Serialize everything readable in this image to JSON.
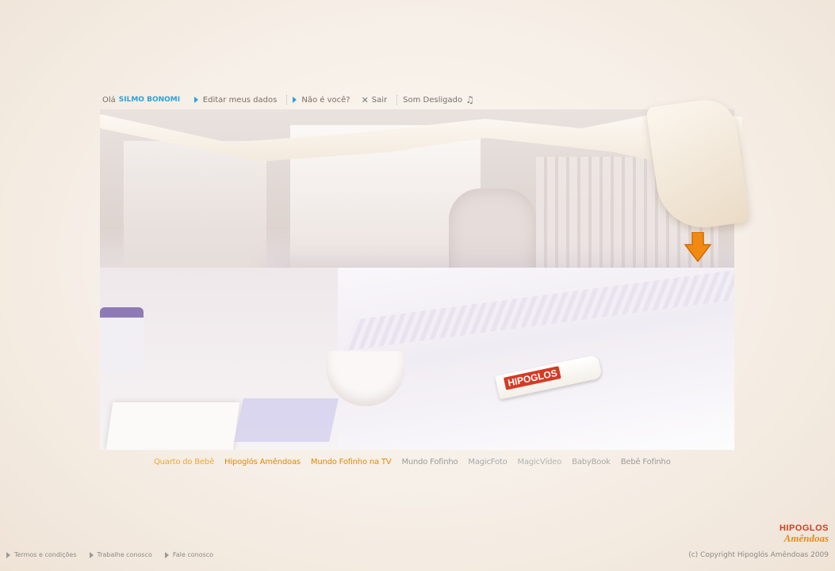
{
  "user_bar": {
    "greeting": "Olá",
    "username": "SILMO BONOMI",
    "edit_link": "Editar meus dados",
    "not_you_link": "Não é você?",
    "logout_link": "Sair",
    "sound_label": "Som Desligado"
  },
  "hero": {
    "product_label": "HIPOGLOS"
  },
  "menu": [
    {
      "label": "Quarto do Bebê",
      "color": "#f0a630"
    },
    {
      "label": "Hipoglós Amêndoas",
      "color": "#e38a00"
    },
    {
      "label": "Mundo Fofinho na TV",
      "color": "#e38a00"
    },
    {
      "label": "Mundo Fofinho",
      "color": "#9a9a9a"
    },
    {
      "label": "MagicFoto",
      "color": "#a8a8a8"
    },
    {
      "label": "MagicVídeo",
      "color": "#b3b3b3"
    },
    {
      "label": "BabyBook",
      "color": "#a8a8a8"
    },
    {
      "label": "Bebê Fofinho",
      "color": "#9a9a9a"
    }
  ],
  "footer": {
    "links": [
      "Termos e condições",
      "Trabalhe conosco",
      "Fale conosco"
    ],
    "copyright": "(c) Copyright Hipoglós Amêndoas 2009"
  },
  "logo": {
    "line1": "HIPOGLOS",
    "line2": "Amêndoas"
  },
  "colors": {
    "accent_blue": "#2ba2d8",
    "accent_orange": "#e38a00",
    "brand_red": "#d8381f"
  }
}
